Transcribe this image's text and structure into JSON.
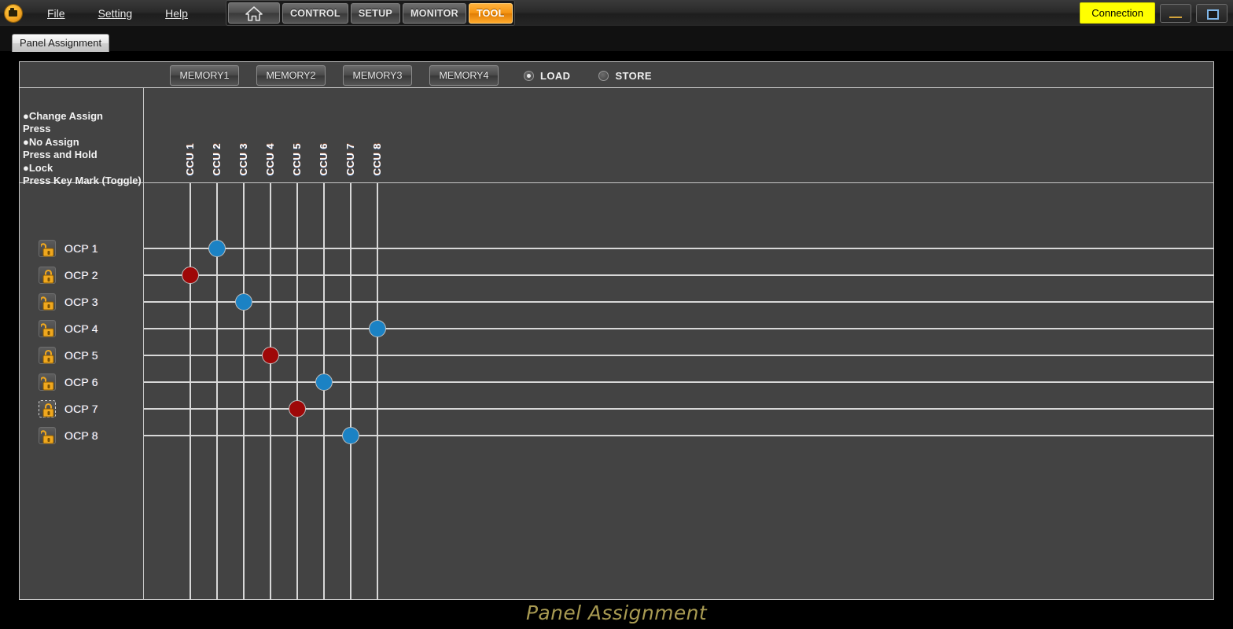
{
  "app": {
    "logo_icon": "camera-logo-icon",
    "footer_title": "Panel Assignment"
  },
  "menubar": {
    "items": [
      {
        "label": "File",
        "accel": "F"
      },
      {
        "label": "Setting",
        "accel": "S"
      },
      {
        "label": "Help",
        "accel": "H"
      }
    ],
    "nav_buttons": [
      {
        "label": "",
        "icon": "home-icon",
        "active": false
      },
      {
        "label": "CONTROL",
        "icon": "",
        "active": false
      },
      {
        "label": "SETUP",
        "icon": "",
        "active": false
      },
      {
        "label": "MONITOR",
        "icon": "",
        "active": false
      },
      {
        "label": "TOOL",
        "icon": "",
        "active": true
      }
    ],
    "connection_label": "Connection",
    "minimize_label": "",
    "maximize_label": ""
  },
  "tabbar": {
    "tabs": [
      {
        "label": "Panel Assignment",
        "selected": true
      }
    ]
  },
  "panel": {
    "memory_buttons": [
      "MEMORY1",
      "MEMORY2",
      "MEMORY3",
      "MEMORY4"
    ],
    "modes": [
      {
        "label": "LOAD",
        "selected": true
      },
      {
        "label": "STORE",
        "selected": false
      }
    ],
    "legend": "●Change Assign\nPress\n●No Assign\nPress and Hold\n●Lock\nPress Key Mark (Toggle)",
    "column_headers": [
      "CCU 1",
      "CCU 2",
      "CCU 3",
      "CCU 4",
      "CCU 5",
      "CCU 6",
      "CCU 7",
      "CCU 8"
    ],
    "rows": [
      {
        "label": "OCP 1",
        "lock_icon": "unlock-icon",
        "locked": false,
        "focused": false
      },
      {
        "label": "OCP 2",
        "lock_icon": "lock-icon",
        "locked": true,
        "focused": false
      },
      {
        "label": "OCP 3",
        "lock_icon": "unlock-icon",
        "locked": false,
        "focused": false
      },
      {
        "label": "OCP 4",
        "lock_icon": "unlock-icon",
        "locked": false,
        "focused": false
      },
      {
        "label": "OCP 5",
        "lock_icon": "lock-icon",
        "locked": true,
        "focused": false
      },
      {
        "label": "OCP 6",
        "lock_icon": "unlock-icon",
        "locked": false,
        "focused": false
      },
      {
        "label": "OCP 7",
        "lock_icon": "lock-icon",
        "locked": true,
        "focused": true
      },
      {
        "label": "OCP 8",
        "lock_icon": "unlock-icon",
        "locked": false,
        "focused": false
      }
    ],
    "assignments": [
      {
        "row": "OCP 1",
        "column": "CCU 2",
        "state": "assigned"
      },
      {
        "row": "OCP 2",
        "column": "CCU 1",
        "state": "locked"
      },
      {
        "row": "OCP 3",
        "column": "CCU 3",
        "state": "assigned"
      },
      {
        "row": "OCP 4",
        "column": "CCU 8",
        "state": "assigned"
      },
      {
        "row": "OCP 5",
        "column": "CCU 4",
        "state": "locked"
      },
      {
        "row": "OCP 6",
        "column": "CCU 6",
        "state": "assigned"
      },
      {
        "row": "OCP 7",
        "column": "CCU 5",
        "state": "locked"
      },
      {
        "row": "OCP 8",
        "column": "CCU 7",
        "state": "assigned"
      }
    ]
  },
  "colors": {
    "assigned_dot": "#1b82c4",
    "locked_dot": "#9e0808",
    "accent_active": "#f59412",
    "connection": "#ffff00",
    "footer_title": "#a89a52",
    "grid_line": "#d8d8d8",
    "panel_bg": "#434343"
  }
}
